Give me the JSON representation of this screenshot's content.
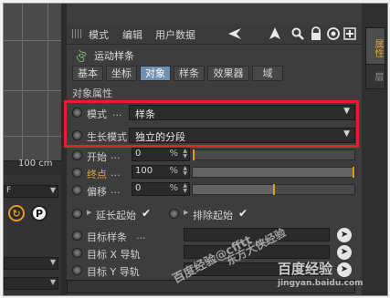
{
  "viewport": {
    "scale_label": "100 cm",
    "dropdown_f": "F",
    "round_buttons": [
      {
        "icon": "refresh-icon",
        "glyph": "↻"
      },
      {
        "icon": "p-icon",
        "glyph": "P"
      }
    ]
  },
  "toolbar": {
    "menu": [
      "模式",
      "编辑",
      "用户数据"
    ],
    "icons": [
      "arrow-left-icon",
      "cursor-icon",
      "search-icon",
      "lock-icon",
      "target-icon",
      "add-icon"
    ]
  },
  "object": {
    "title": "运动样条"
  },
  "tabs": [
    {
      "label": "基本",
      "active": false
    },
    {
      "label": "坐标",
      "active": false
    },
    {
      "label": "对象",
      "active": true
    },
    {
      "label": "样条",
      "active": false
    },
    {
      "label": "效果器",
      "active": false
    },
    {
      "label": "域",
      "active": false
    }
  ],
  "section": {
    "title": "对象属性"
  },
  "props": {
    "mode": {
      "label": "模式",
      "dots": "...",
      "value": "样条"
    },
    "growth": {
      "label": "生长模式",
      "value": "独立的分段"
    },
    "start": {
      "label": "开始",
      "dots": "...",
      "value": "0",
      "unit": "%",
      "fraction": 0.0
    },
    "end": {
      "label": "终点",
      "dots": "...",
      "value": "100",
      "unit": "%",
      "fraction": 1.0
    },
    "offset": {
      "label": "偏移",
      "dots": "...",
      "value": "0",
      "unit": "%",
      "fraction": 0.5
    }
  },
  "checks": {
    "extend_start": {
      "label": "延长起始",
      "mark": "✔"
    },
    "exclude_start": {
      "label": "排除起始",
      "mark": "✔"
    }
  },
  "targets": {
    "spline": {
      "label": "目标样条",
      "dots": "..."
    },
    "rail_x": {
      "label": "目标 X 导轨"
    },
    "rail_y": {
      "label": "目标 Y 导轨"
    }
  },
  "side_tabs": [
    "属性",
    "层"
  ],
  "watermark": {
    "line1": "百度经验",
    "line2": "jingyan.baidu.com",
    "stamp": "百度经验@cfftt",
    "stamp2": "东方大侠经验"
  },
  "colors": {
    "accent_tab": "#6f8fb3",
    "highlight_box": "#e0222a",
    "slider_knob": "#e39a1a",
    "end_label": "#e3a53c",
    "object_icon": "#7fd27f"
  }
}
